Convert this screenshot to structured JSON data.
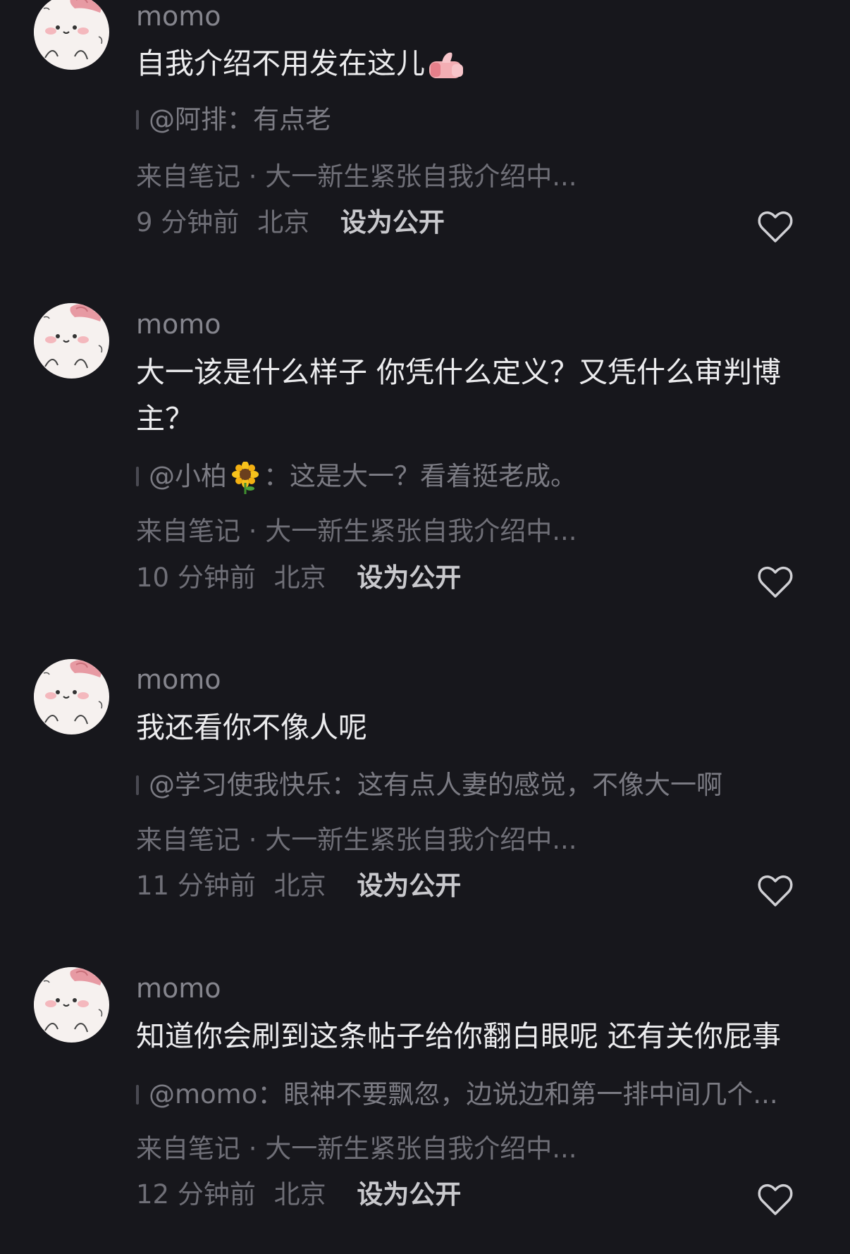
{
  "comments": [
    {
      "username": "momo",
      "text": "自我介绍不用发在这儿",
      "text_emoji": "thumbs-up-emoji",
      "quote_user": "@阿排",
      "quote_sep": "：",
      "quote_text": "有点老",
      "source": "来自笔记 · 大一新生紧张自我介绍中...",
      "time": "9 分钟前",
      "location": "北京",
      "public_label": "设为公开"
    },
    {
      "username": "momo",
      "text": "大一该是什么样子 你凭什么定义？又凭什么审判博主？",
      "quote_user": "@小柏",
      "quote_emoji": "sunflower-emoji",
      "quote_sep": "：",
      "quote_text": "这是大一？看着挺老成。",
      "source": "来自笔记 · 大一新生紧张自我介绍中...",
      "time": "10 分钟前",
      "location": "北京",
      "public_label": "设为公开"
    },
    {
      "username": "momo",
      "text": "我还看你不像人呢",
      "quote_user": "@学习使我快乐",
      "quote_sep": "：",
      "quote_text": "这有点人妻的感觉，不像大一啊",
      "source": "来自笔记 · 大一新生紧张自我介绍中...",
      "time": "11 分钟前",
      "location": "北京",
      "public_label": "设为公开"
    },
    {
      "username": "momo",
      "text": "知道你会刷到这条帖子给你翻白眼呢 还有关你屁事",
      "quote_user": "@momo",
      "quote_sep": "：",
      "quote_text": "眼神不要飘忽，边说边和第一排中间几个...",
      "source": "来自笔记 · 大一新生紧张自我介绍中...",
      "time": "12 分钟前",
      "location": "北京",
      "public_label": "设为公开"
    }
  ],
  "icons": {
    "avatar": "cartoon-blob-avatar",
    "like": "heart-outline-icon"
  },
  "colors": {
    "background": "#17171c",
    "text_primary": "#ececee",
    "text_secondary": "#6f6f77",
    "action": "#c9c9cd"
  }
}
